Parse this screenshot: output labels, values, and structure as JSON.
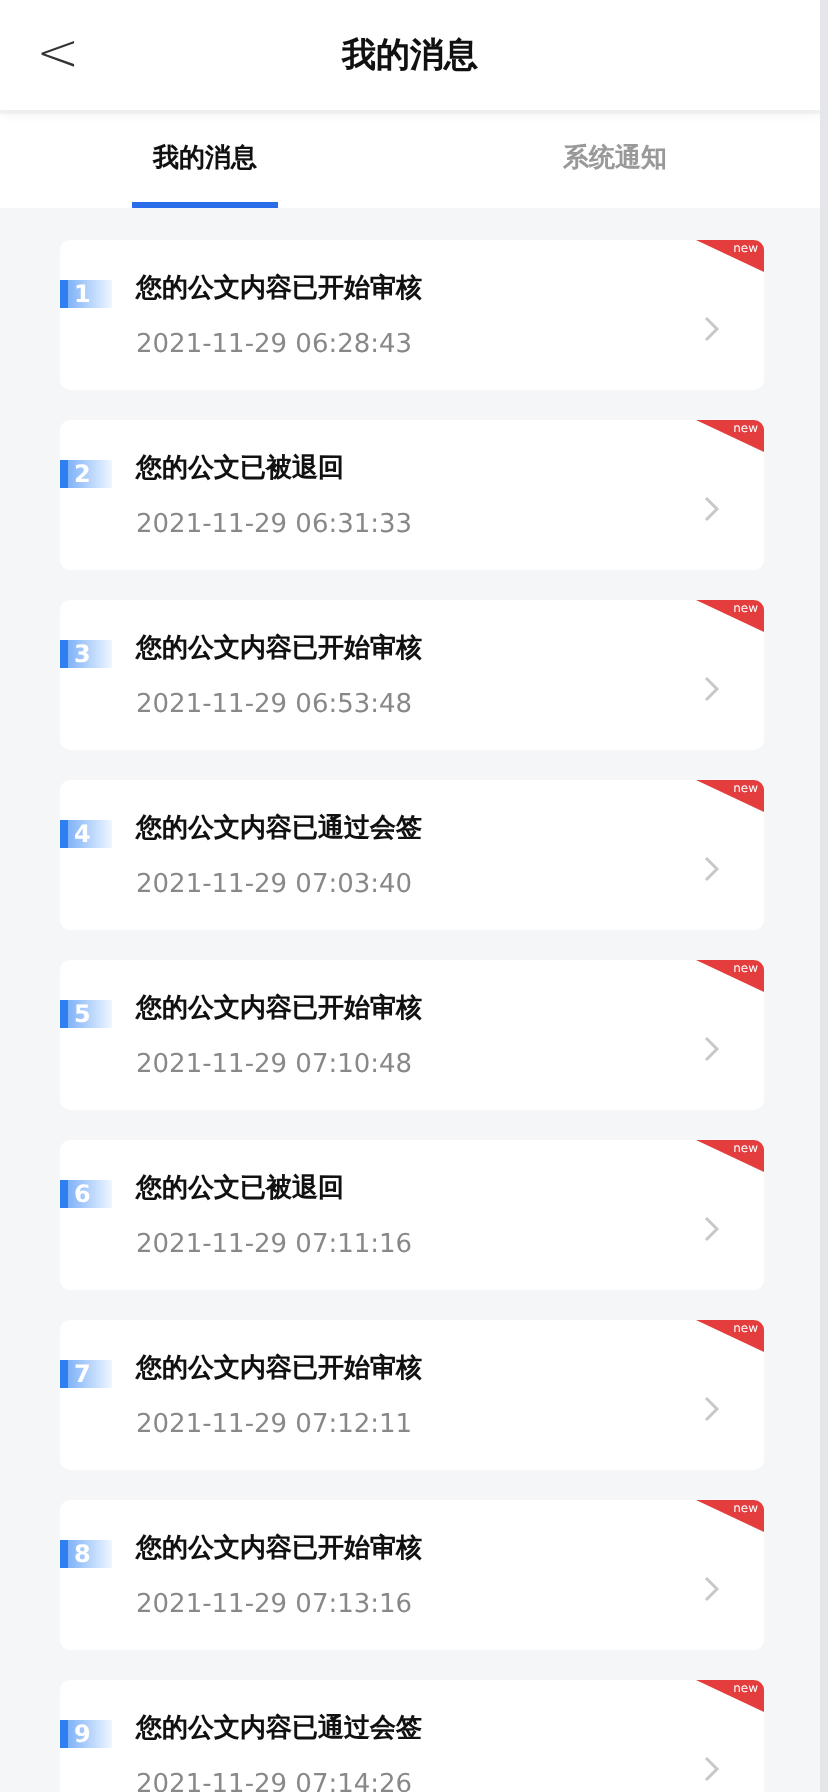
{
  "header": {
    "back": "<",
    "title": "我的消息"
  },
  "tabs": [
    {
      "label": "我的消息",
      "selected": true
    },
    {
      "label": "系统通知",
      "selected": false
    }
  ],
  "messages": [
    {
      "index": "1",
      "title": "您的公文内容已开始审核",
      "time": "2021-11-29 06:28:43",
      "badge": "new"
    },
    {
      "index": "2",
      "title": "您的公文已被退回",
      "time": "2021-11-29 06:31:33",
      "badge": "new"
    },
    {
      "index": "3",
      "title": "您的公文内容已开始审核",
      "time": "2021-11-29 06:53:48",
      "badge": "new"
    },
    {
      "index": "4",
      "title": "您的公文内容已通过会签",
      "time": "2021-11-29 07:03:40",
      "badge": "new"
    },
    {
      "index": "5",
      "title": "您的公文内容已开始审核",
      "time": "2021-11-29 07:10:48",
      "badge": "new"
    },
    {
      "index": "6",
      "title": "您的公文已被退回",
      "time": "2021-11-29 07:11:16",
      "badge": "new"
    },
    {
      "index": "7",
      "title": "您的公文内容已开始审核",
      "time": "2021-11-29 07:12:11",
      "badge": "new"
    },
    {
      "index": "8",
      "title": "您的公文内容已开始审核",
      "time": "2021-11-29 07:13:16",
      "badge": "new"
    },
    {
      "index": "9",
      "title": "您的公文内容已通过会签",
      "time": "2021-11-29 07:14:26",
      "badge": "new"
    }
  ]
}
